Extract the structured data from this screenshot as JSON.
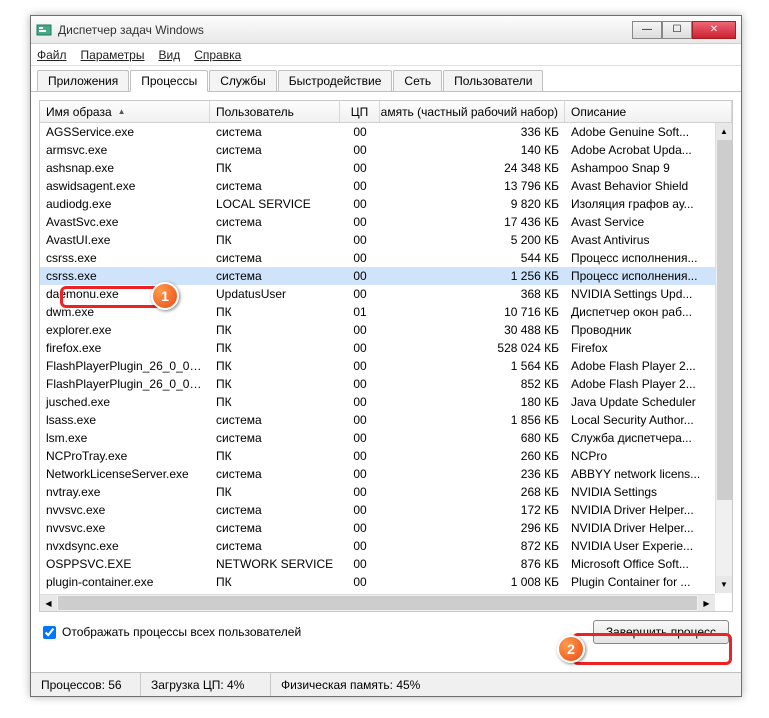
{
  "window": {
    "title": "Диспетчер задач Windows"
  },
  "menu": {
    "file": "Файл",
    "options": "Параметры",
    "view": "Вид",
    "help": "Справка"
  },
  "tabs": [
    {
      "label": "Приложения"
    },
    {
      "label": "Процессы"
    },
    {
      "label": "Службы"
    },
    {
      "label": "Быстродействие"
    },
    {
      "label": "Сеть"
    },
    {
      "label": "Пользователи"
    }
  ],
  "active_tab": 1,
  "columns": {
    "image": "Имя образа",
    "user": "Пользователь",
    "cpu": "ЦП",
    "mem": "Память (частный рабочий набор)",
    "desc": "Описание"
  },
  "processes": [
    {
      "img": "AGSService.exe",
      "user": "система",
      "cpu": "00",
      "mem": "336 КБ",
      "desc": "Adobe Genuine Soft..."
    },
    {
      "img": "armsvc.exe",
      "user": "система",
      "cpu": "00",
      "mem": "140 КБ",
      "desc": "Adobe Acrobat Upda..."
    },
    {
      "img": "ashsnap.exe",
      "user": "ПК",
      "cpu": "00",
      "mem": "24 348 КБ",
      "desc": "Ashampoo Snap 9"
    },
    {
      "img": "aswidsagent.exe",
      "user": "система",
      "cpu": "00",
      "mem": "13 796 КБ",
      "desc": "Avast Behavior Shield"
    },
    {
      "img": "audiodg.exe",
      "user": "LOCAL SERVICE",
      "cpu": "00",
      "mem": "9 820 КБ",
      "desc": "Изоляция графов ау..."
    },
    {
      "img": "AvastSvc.exe",
      "user": "система",
      "cpu": "00",
      "mem": "17 436 КБ",
      "desc": "Avast Service"
    },
    {
      "img": "AvastUI.exe",
      "user": "ПК",
      "cpu": "00",
      "mem": "5 200 КБ",
      "desc": "Avast Antivirus"
    },
    {
      "img": "csrss.exe",
      "user": "система",
      "cpu": "00",
      "mem": "544 КБ",
      "desc": "Процесс исполнения..."
    },
    {
      "img": "csrss.exe",
      "user": "система",
      "cpu": "00",
      "mem": "1 256 КБ",
      "desc": "Процесс исполнения...",
      "selected": true
    },
    {
      "img": "daemonu.exe",
      "user": "UpdatusUser",
      "cpu": "00",
      "mem": "368 КБ",
      "desc": "NVIDIA Settings Upd..."
    },
    {
      "img": "dwm.exe",
      "user": "ПК",
      "cpu": "01",
      "mem": "10 716 КБ",
      "desc": "Диспетчер окон раб..."
    },
    {
      "img": "explorer.exe",
      "user": "ПК",
      "cpu": "00",
      "mem": "30 488 КБ",
      "desc": "Проводник"
    },
    {
      "img": "firefox.exe",
      "user": "ПК",
      "cpu": "00",
      "mem": "528 024 КБ",
      "desc": "Firefox"
    },
    {
      "img": "FlashPlayerPlugin_26_0_0_1...",
      "user": "ПК",
      "cpu": "00",
      "mem": "1 564 КБ",
      "desc": "Adobe Flash Player 2..."
    },
    {
      "img": "FlashPlayerPlugin_26_0_0_1...",
      "user": "ПК",
      "cpu": "00",
      "mem": "852 КБ",
      "desc": "Adobe Flash Player 2..."
    },
    {
      "img": "jusched.exe",
      "user": "ПК",
      "cpu": "00",
      "mem": "180 КБ",
      "desc": "Java Update Scheduler"
    },
    {
      "img": "lsass.exe",
      "user": "система",
      "cpu": "00",
      "mem": "1 856 КБ",
      "desc": "Local Security Author..."
    },
    {
      "img": "lsm.exe",
      "user": "система",
      "cpu": "00",
      "mem": "680 КБ",
      "desc": "Служба диспетчера..."
    },
    {
      "img": "NCProTray.exe",
      "user": "ПК",
      "cpu": "00",
      "mem": "260 КБ",
      "desc": "NCPro"
    },
    {
      "img": "NetworkLicenseServer.exe",
      "user": "система",
      "cpu": "00",
      "mem": "236 КБ",
      "desc": "ABBYY network licens..."
    },
    {
      "img": "nvtray.exe",
      "user": "ПК",
      "cpu": "00",
      "mem": "268 КБ",
      "desc": "NVIDIA Settings"
    },
    {
      "img": "nvvsvc.exe",
      "user": "система",
      "cpu": "00",
      "mem": "172 КБ",
      "desc": "NVIDIA Driver Helper..."
    },
    {
      "img": "nvvsvc.exe",
      "user": "система",
      "cpu": "00",
      "mem": "296 КБ",
      "desc": "NVIDIA Driver Helper..."
    },
    {
      "img": "nvxdsync.exe",
      "user": "система",
      "cpu": "00",
      "mem": "872 КБ",
      "desc": "NVIDIA User Experie..."
    },
    {
      "img": "OSPPSVC.EXE",
      "user": "NETWORK SERVICE",
      "cpu": "00",
      "mem": "876 КБ",
      "desc": "Microsoft Office Soft..."
    },
    {
      "img": "plugin-container.exe",
      "user": "ПК",
      "cpu": "00",
      "mem": "1 008 КБ",
      "desc": "Plugin Container for ..."
    }
  ],
  "selected_index": 8,
  "checkbox": {
    "label": "Отображать процессы всех пользователей",
    "checked": true
  },
  "end_process_btn": "Завершить процесс",
  "status": {
    "processes": "Процессов: 56",
    "cpu": "Загрузка ЦП: 4%",
    "mem": "Физическая память: 45%"
  },
  "callouts": {
    "c1": "1",
    "c2": "2"
  }
}
